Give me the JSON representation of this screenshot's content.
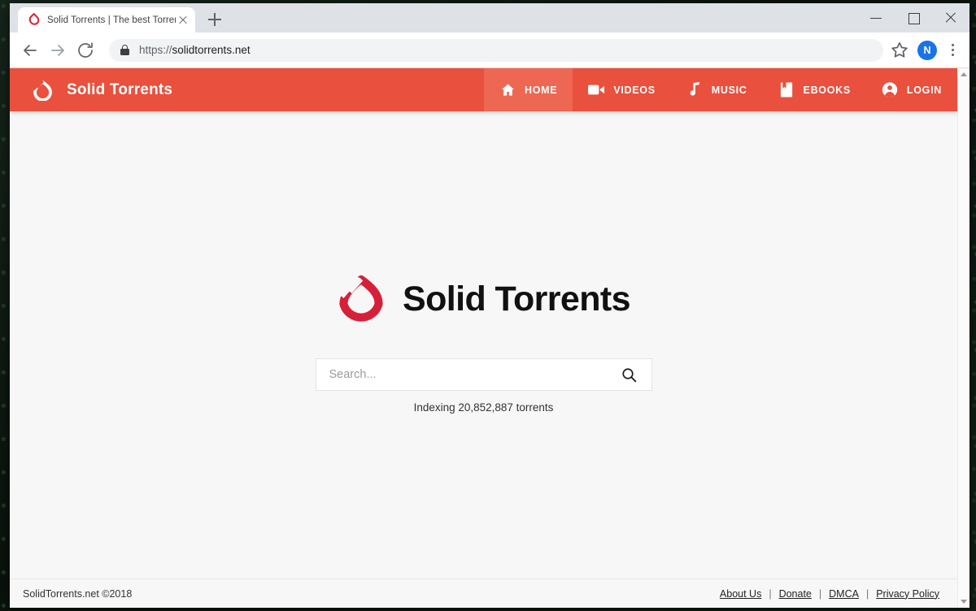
{
  "browser": {
    "tab": {
      "title": "Solid Torrents | The best Torrent ",
      "favicon": "solid-torrents-favicon",
      "close_label": "close-tab"
    },
    "new_tab_label": "new-tab",
    "window_controls": {
      "minimize": "minimize",
      "maximize": "maximize",
      "close": "close"
    },
    "toolbar": {
      "back": "back",
      "forward": "forward",
      "reload": "reload",
      "lock_icon": "lock-icon",
      "url_scheme": "https://",
      "url_host": "solidtorrents.net",
      "url_full": "https://solidtorrents.net",
      "bookmark": "bookmark-star",
      "profile_initial": "N",
      "menu": "chrome-menu"
    }
  },
  "site": {
    "nav": {
      "brand": "Solid Torrents",
      "brand_icon": "solid-torrents-logo",
      "accent_color": "#e9503d",
      "active_color": "#ee6753",
      "items": [
        {
          "label": "HOME",
          "icon": "home-icon",
          "active": true
        },
        {
          "label": "VIDEOS",
          "icon": "video-icon",
          "active": false
        },
        {
          "label": "MUSIC",
          "icon": "music-icon",
          "active": false
        },
        {
          "label": "EBOOKS",
          "icon": "book-icon",
          "active": false
        },
        {
          "label": "LOGIN",
          "icon": "account-icon",
          "active": false
        }
      ]
    },
    "hero": {
      "logo_icon": "solid-torrents-logo-large",
      "logo_color": "#d6203a",
      "wordmark": "Solid Torrents"
    },
    "search": {
      "placeholder": "Search...",
      "value": "",
      "button_icon": "search-icon",
      "indexing_text": "Indexing 20,852,887 torrents"
    },
    "footer": {
      "copyright": "SolidTorrents.net ©2018",
      "links": [
        {
          "label": "About Us"
        },
        {
          "label": "Donate"
        },
        {
          "label": "DMCA"
        },
        {
          "label": "Privacy Policy"
        }
      ],
      "separator": "|"
    }
  }
}
